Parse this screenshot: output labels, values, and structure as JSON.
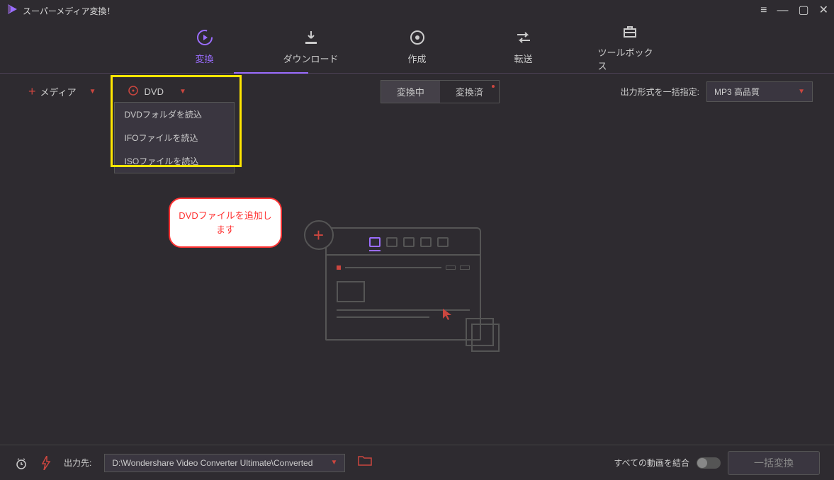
{
  "title": "スーパーメディア変換！",
  "nav": {
    "convert": "変換",
    "download": "ダウンロード",
    "create": "作成",
    "transfer": "転送",
    "toolbox": "ツールボックス"
  },
  "toolbar": {
    "media_label": "メディア",
    "dvd_label": "DVD",
    "dvd_menu": {
      "folder": "DVDフォルダを読込",
      "ifo": "IFOファイルを読込",
      "iso": "ISOファイルを読込"
    },
    "status_converting": "変換中",
    "status_converted": "変換済",
    "output_format_label": "出力形式を一括指定:",
    "output_format_value": "MP3 高品質"
  },
  "callout": {
    "text": "DVDファイルを追加します"
  },
  "footer": {
    "output_label": "出力先:",
    "output_path": "D:\\Wondershare Video Converter Ultimate\\Converted",
    "merge_label": "すべての動画を結合",
    "batch_button": "一括変換"
  }
}
